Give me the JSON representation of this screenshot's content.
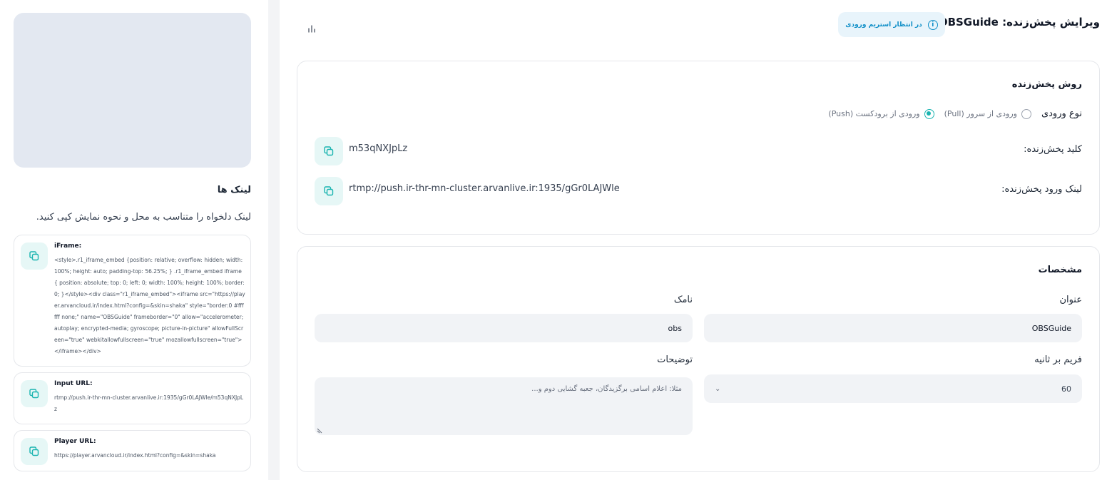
{
  "header": {
    "title": "ویرایش پخش‌زنده: OBSGuide",
    "status_text": "در انتظار استریم ورودی",
    "status_icon": "info-icon",
    "stats_icon": "bar-chart-icon"
  },
  "broadcast_method": {
    "title": "روش پخش‌زنده",
    "input_type_label": "نوع ورودی",
    "options": [
      {
        "label": "ورودی از سرور (Pull)",
        "checked": false
      },
      {
        "label": "ورودی از برودکست (Push)",
        "checked": true
      }
    ],
    "stream_key_label": "کلید پخش‌زنده:",
    "stream_key": "m53qNXJpLz",
    "input_link_label": "لینک ورود پخش‌زنده:",
    "input_link": "rtmp://push.ir-thr-mn-cluster.arvanlive.ir:1935/gGr0LAJWle"
  },
  "specs": {
    "title": "مشخصات",
    "title_label": "عنوان",
    "title_value": "OBSGuide",
    "slug_label": "نامک",
    "slug_value": "obs",
    "fps_label": "فریم بر ثانیه",
    "fps_value": "60",
    "description_label": "توضیحات",
    "description_placeholder": "مثلا: اعلام اسامی برگزیدگان، جعبه گشایی دوم و..."
  },
  "links": {
    "title": "لینک ها",
    "description": "لینک دلخواه را متناسب به محل و نحوه نمایش کپی کنید.",
    "items": [
      {
        "title": "iFrame:",
        "text": "<style>.r1_iframe_embed {position: relative; overflow: hidden; width: 100%; height: auto; padding-top: 56.25%; } .r1_iframe_embed iframe { position: absolute; top: 0; left: 0; width: 100%; height: 100%; border: 0; }</style><div class=\"r1_iframe_embed\"><iframe src=\"https://player.arvancloud.ir/index.html?config=&skin=shaka\" style=\"border:0 #ffffff none;\" name=\"OBSGuide\" frameborder=\"0\" allow=\"accelerometer; autoplay; encrypted-media; gyroscope; picture-in-picture\" allowFullScreen=\"true\" webkitallowfullscreen=\"true\" mozallowfullscreen=\"true\"></iframe></div>"
      },
      {
        "title": "Input URL:",
        "text": "rtmp://push.ir-thr-mn-cluster.arvanlive.ir:1935/gGr0LAJWle/m53qNXJpLz"
      },
      {
        "title": "Player URL:",
        "text": "https://player.arvancloud.ir/index.html?config=&skin=shaka"
      }
    ]
  },
  "colors": {
    "accent": "#1ab4b0",
    "status_blue": "#0e8ec7",
    "preview_bg": "#e3e8f1"
  }
}
